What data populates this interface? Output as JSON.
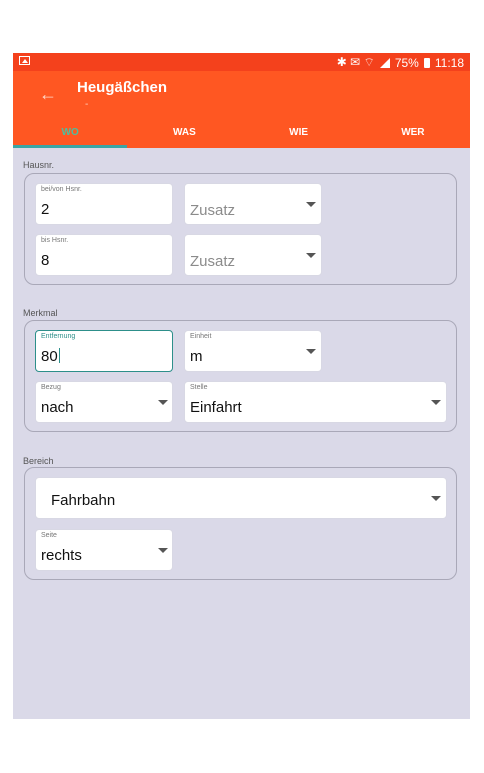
{
  "status": {
    "icons": "✱ ✉ ⌔",
    "battery": "75%",
    "time": "11:18"
  },
  "header": {
    "back_icon": "arrow-left-icon",
    "title": "Heugäßchen",
    "subtitle": "-"
  },
  "tabs": [
    {
      "label": "WO"
    },
    {
      "label": "WAS"
    },
    {
      "label": "WIE"
    },
    {
      "label": "WER"
    }
  ],
  "hausnr": {
    "label": "Hausnr.",
    "from_label": "bei/von Hsnr.",
    "from_value": "2",
    "zusatz1_placeholder": "Zusatz",
    "to_label": "bis Hsnr.",
    "to_value": "8",
    "zusatz2_placeholder": "Zusatz"
  },
  "merkmal": {
    "label": "Merkmal",
    "entfernung_label": "Entfernung",
    "entfernung_value": "80",
    "einheit_label": "Einheit",
    "einheit_value": "m",
    "bezug_label": "Bezug",
    "bezug_value": "nach",
    "stelle_label": "Stelle",
    "stelle_value": "Einfahrt"
  },
  "bereich": {
    "label": "Bereich",
    "bereich_value": "Fahrbahn",
    "seite_label": "Seite",
    "seite_value": "rechts"
  }
}
